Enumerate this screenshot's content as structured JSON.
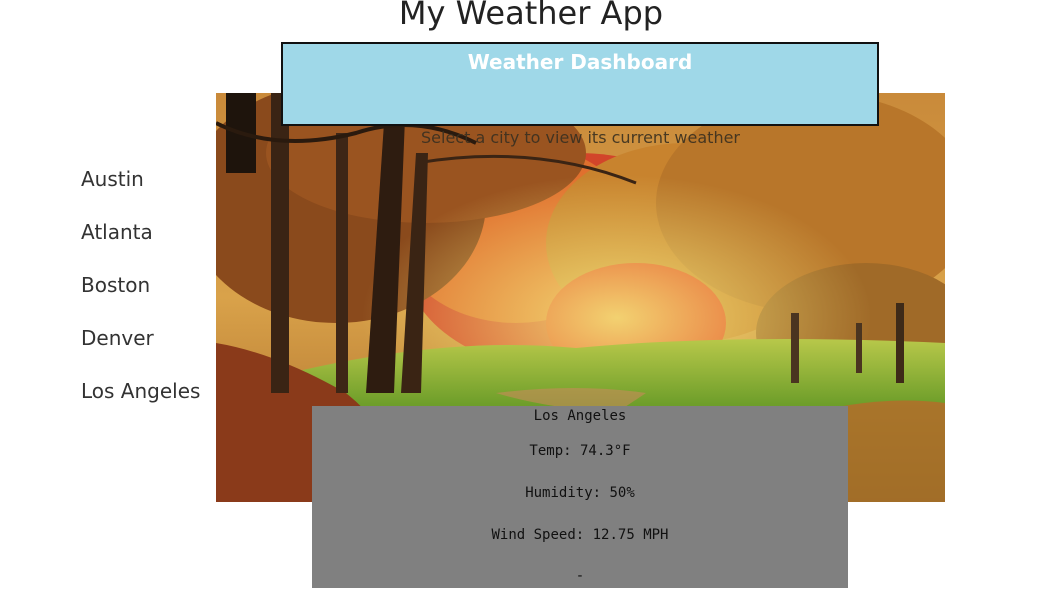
{
  "app": {
    "title": "My Weather App"
  },
  "banner": {
    "title": "Weather Dashboard",
    "color": "#9fd8e8"
  },
  "hint": {
    "text": "Select a city to view its current weather"
  },
  "sidebar": {
    "cities": [
      {
        "label": "Austin"
      },
      {
        "label": "Atlanta"
      },
      {
        "label": "Boston"
      },
      {
        "label": "Denver"
      },
      {
        "label": "Los Angeles"
      }
    ]
  },
  "weather": {
    "city": "Los Angeles",
    "temp": "Temp: 74.3°F",
    "humidity": "Humidity: 50%",
    "wind": "Wind Speed: 12.75 MPH",
    "footer": "-",
    "card_color": "#808080"
  },
  "background": {
    "icon": "autumn-forest-image"
  }
}
